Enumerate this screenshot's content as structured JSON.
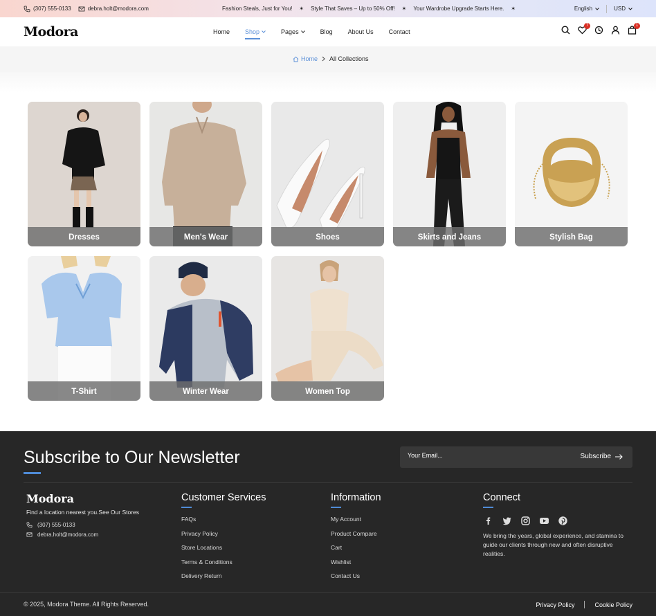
{
  "topbar": {
    "phone": "(307) 555-0133",
    "email": "debra.holt@modora.com",
    "promos": [
      "Fashion Steals, Just for You!",
      "Style That Saves – Up to 50% Off!",
      "Your Wardrobe Upgrade Starts Here."
    ],
    "language": "English",
    "currency": "USD"
  },
  "header": {
    "logo": "Modora",
    "nav": [
      {
        "label": "Home"
      },
      {
        "label": "Shop"
      },
      {
        "label": "Pages"
      },
      {
        "label": "Blog"
      },
      {
        "label": "About Us"
      },
      {
        "label": "Contact"
      }
    ],
    "wishlist_count": "7",
    "cart_count": "1"
  },
  "breadcrumb": {
    "home": "Home",
    "current": "All Collections"
  },
  "collections": [
    {
      "label": "Dresses"
    },
    {
      "label": "Men's Wear"
    },
    {
      "label": "Shoes"
    },
    {
      "label": "Skirts and Jeans"
    },
    {
      "label": "Stylish Bag"
    },
    {
      "label": "T-Shirt"
    },
    {
      "label": "Winter Wear"
    },
    {
      "label": "Women Top"
    }
  ],
  "footer": {
    "newsletter_title": "Subscribe to Our Newsletter",
    "email_placeholder": "Your Email...",
    "subscribe_label": "Subscribe",
    "logo": "Modora",
    "tagline": "Find a location nearest you.See Our Stores",
    "phone": "(307) 555-0133",
    "email": "debra.holt@modora.com",
    "customer_services": {
      "title": "Customer Services",
      "links": [
        "FAQs",
        "Privacy Policy",
        "Store Locations",
        "Terms & Conditions",
        "Delivery Return"
      ]
    },
    "information": {
      "title": "Information",
      "links": [
        "My Account",
        "Product Compare",
        "Cart",
        "Wishlist",
        "Contact Us"
      ]
    },
    "connect": {
      "title": "Connect",
      "socials": [
        "facebook-icon",
        "twitter-icon",
        "instagram-icon",
        "youtube-icon",
        "pinterest-icon"
      ],
      "about": "We bring the years, global experience, and stamina to guide our clients through new and often disruptive realities."
    },
    "copyright": "© 2025, Modora Theme. All Rights Reserved.",
    "privacy": "Privacy Policy",
    "cookie": "Cookie Policy"
  },
  "colors": {
    "accent": "#5a8fd8",
    "footer_bg": "#272727",
    "badge": "#d93025"
  }
}
